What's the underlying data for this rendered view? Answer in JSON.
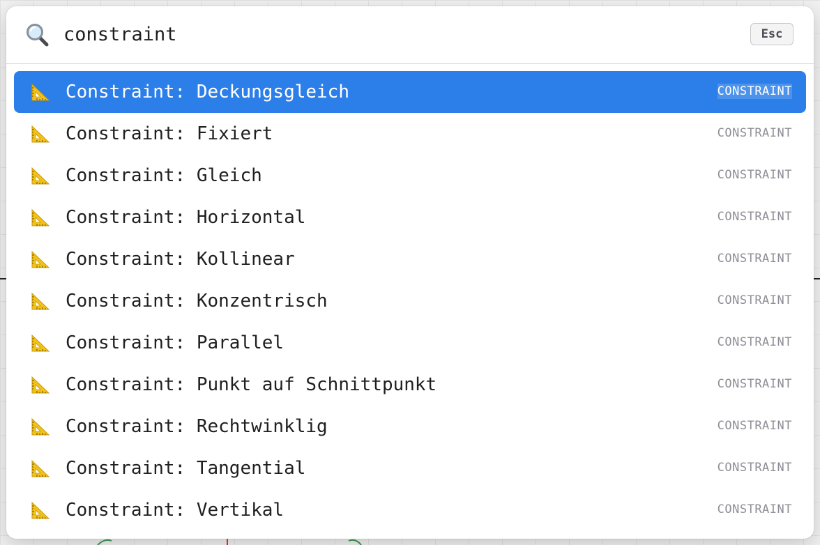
{
  "search": {
    "icon": "magnifying-glass-icon",
    "value": "constraint",
    "esc_label": "Esc"
  },
  "results": [
    {
      "label": "Constraint: Deckungsgleich",
      "tag": "CONSTRAINT",
      "icon": "triangular-ruler-icon",
      "selected": true
    },
    {
      "label": "Constraint: Fixiert",
      "tag": "CONSTRAINT",
      "icon": "triangular-ruler-icon",
      "selected": false
    },
    {
      "label": "Constraint: Gleich",
      "tag": "CONSTRAINT",
      "icon": "triangular-ruler-icon",
      "selected": false
    },
    {
      "label": "Constraint: Horizontal",
      "tag": "CONSTRAINT",
      "icon": "triangular-ruler-icon",
      "selected": false
    },
    {
      "label": "Constraint: Kollinear",
      "tag": "CONSTRAINT",
      "icon": "triangular-ruler-icon",
      "selected": false
    },
    {
      "label": "Constraint: Konzentrisch",
      "tag": "CONSTRAINT",
      "icon": "triangular-ruler-icon",
      "selected": false
    },
    {
      "label": "Constraint: Parallel",
      "tag": "CONSTRAINT",
      "icon": "triangular-ruler-icon",
      "selected": false
    },
    {
      "label": "Constraint: Punkt auf Schnittpunkt",
      "tag": "CONSTRAINT",
      "icon": "triangular-ruler-icon",
      "selected": false
    },
    {
      "label": "Constraint: Rechtwinklig",
      "tag": "CONSTRAINT",
      "icon": "triangular-ruler-icon",
      "selected": false
    },
    {
      "label": "Constraint: Tangential",
      "tag": "CONSTRAINT",
      "icon": "triangular-ruler-icon",
      "selected": false
    },
    {
      "label": "Constraint: Vertikal",
      "tag": "CONSTRAINT",
      "icon": "triangular-ruler-icon",
      "selected": false
    }
  ],
  "colors": {
    "selection": "#2c7fe8",
    "tag_text": "#8e8e96",
    "ruler_yellow": "#f2c21b"
  }
}
